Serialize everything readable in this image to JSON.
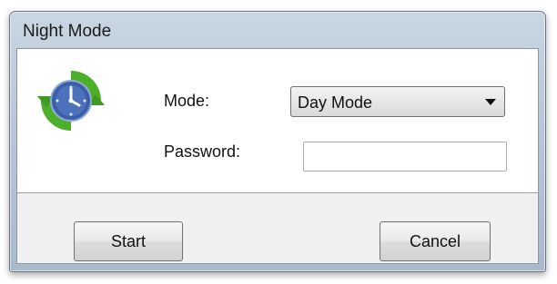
{
  "window": {
    "title": "Night Mode"
  },
  "app_icon": "clock-refresh-icon",
  "form": {
    "mode_label": "Mode:",
    "mode_value": "Day Mode",
    "password_label": "Password:",
    "password_value": "",
    "password_placeholder": ""
  },
  "buttons": {
    "start_label": "Start",
    "cancel_label": "Cancel"
  },
  "colors": {
    "frame": "#b7c7d7",
    "icon_arrows": "#4caf2a",
    "icon_clock": "#3a5fa8"
  }
}
